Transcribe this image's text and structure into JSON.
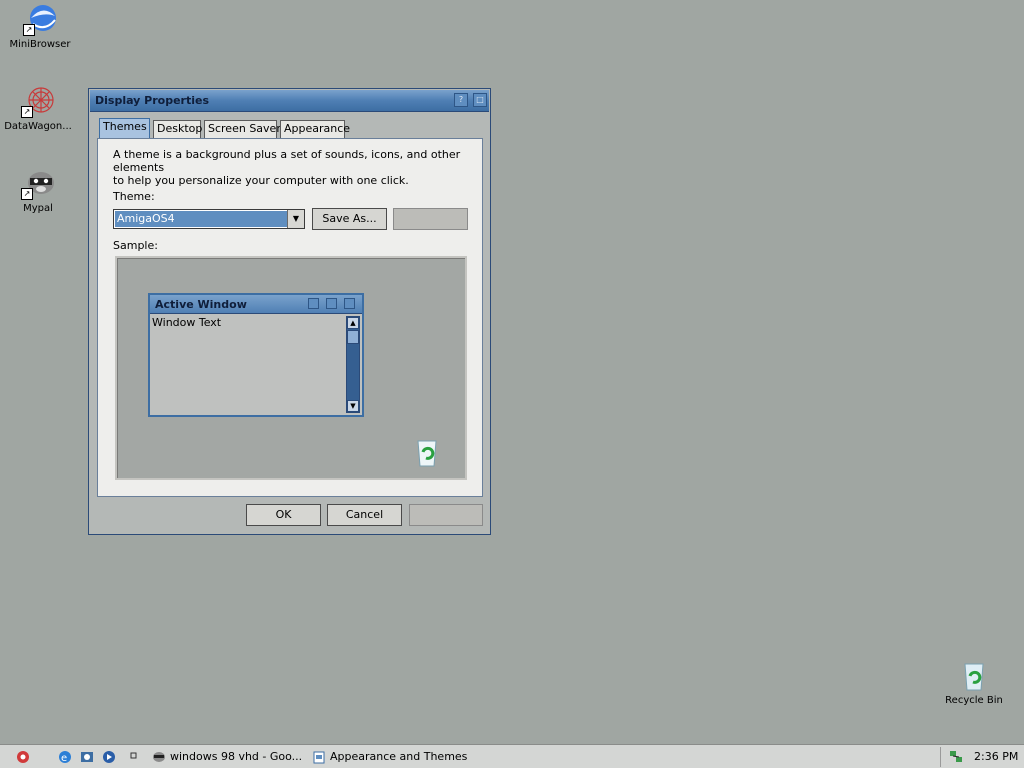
{
  "desktop": {
    "icons": [
      {
        "label": "MiniBrowser",
        "icon": "globe-icon"
      },
      {
        "label": "DataWagon...",
        "icon": "flower-icon"
      },
      {
        "label": "Mypal",
        "icon": "raccoon-icon"
      },
      {
        "label": "Recycle Bin",
        "icon": "recycle-bin-icon"
      }
    ]
  },
  "dialog": {
    "title": "Display Properties",
    "tabs": [
      "Themes",
      "Desktop",
      "Screen Saver",
      "Appearance"
    ],
    "active_tab": "Themes",
    "description_line1": "A theme is a background plus a set of sounds, icons, and other elements",
    "description_line2": "to help you personalize your computer with one click.",
    "theme_label": "Theme:",
    "theme_value": "AmigaOS4",
    "save_as_label": "Save As...",
    "delete_label": "",
    "sample_label": "Sample:",
    "sample": {
      "window_title": "Active Window",
      "window_text": "Window Text"
    },
    "ok_label": "OK",
    "cancel_label": "Cancel",
    "apply_label": ""
  },
  "taskbar": {
    "items": [
      {
        "label": "windows 98 vhd - Goo...",
        "icon": "raccoon-icon"
      },
      {
        "label": "Appearance and Themes",
        "icon": "folder-icon"
      }
    ],
    "clock": "2:36 PM"
  },
  "colors": {
    "desktop": "#a0a6a2",
    "title_blue": "#4f7fb4",
    "selection": "#5f8ec0"
  }
}
